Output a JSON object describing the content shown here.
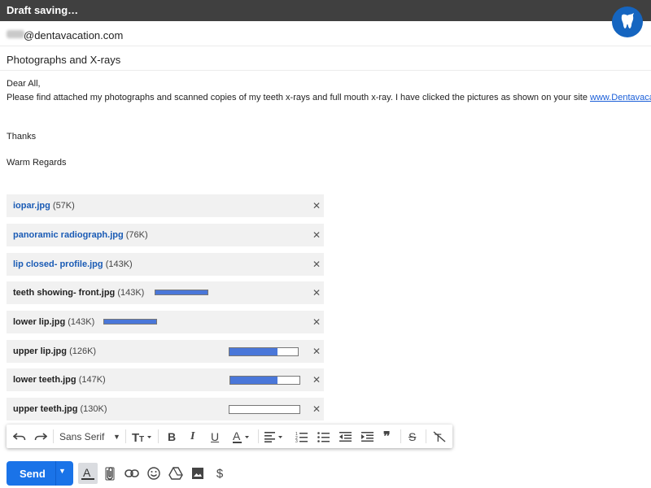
{
  "window": {
    "title": "Draft saving…"
  },
  "logo": {
    "icon": "tooth-icon",
    "color": "#1565c0"
  },
  "compose": {
    "to": "@dentavacation.com",
    "subject": "Photographs and X-rays",
    "body": {
      "greeting": "Dear All,",
      "line1": "Please find attached my photographs and scanned copies of my teeth x-rays and full mouth x-ray. I have clicked the pictures as shown on your site ",
      "link": "www.Dentavaca",
      "thanks": "Thanks",
      "regards": "Warm Regards"
    }
  },
  "attachments": [
    {
      "name": "iopar.jpg",
      "size": "(57K)",
      "status": "done"
    },
    {
      "name": "panoramic radiograph.jpg",
      "size": "(76K)",
      "status": "done"
    },
    {
      "name": "lip closed- profile.jpg",
      "size": "(143K)",
      "status": "done"
    },
    {
      "name": "teeth showing- front.jpg",
      "size": "(143K)",
      "status": "processing"
    },
    {
      "name": "lower lip.jpg",
      "size": "(143K)",
      "status": "processing"
    },
    {
      "name": "upper lip.jpg",
      "size": "(126K)",
      "status": "uploading",
      "progress": 0.7
    },
    {
      "name": "lower teeth.jpg",
      "size": "(147K)",
      "status": "uploading",
      "progress": 0.68
    },
    {
      "name": "upper teeth.jpg",
      "size": "(130K)",
      "status": "uploading",
      "progress": 0.0
    }
  ],
  "toolbar": {
    "font": "Sans Serif",
    "accent": "#444444"
  },
  "send": {
    "label": "Send",
    "color": "#1a73e8"
  },
  "bottom_icons": [
    "formatting-icon",
    "attach-icon",
    "link-icon",
    "emoji-icon",
    "drive-icon",
    "photo-icon",
    "dollar-icon"
  ]
}
